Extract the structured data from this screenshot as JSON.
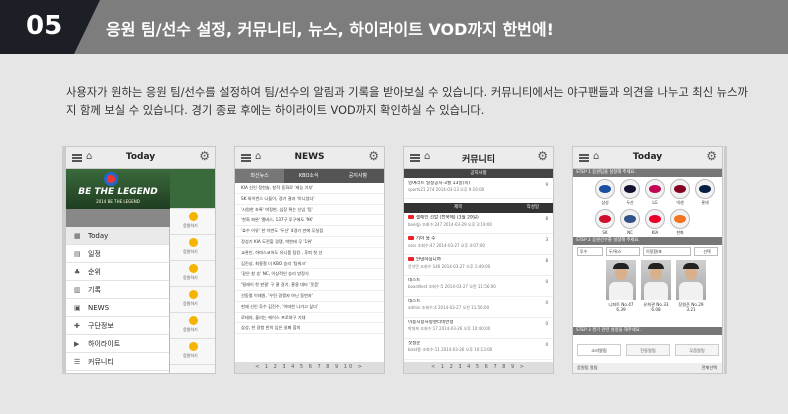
{
  "banner": {
    "number": "05",
    "title": "응원 팀/선수 설정, 커뮤니티, 뉴스, 하이라이트 VOD까지 한번에!"
  },
  "description": "사용자가 원하는 응원 팀/선수를 설정하여 팀/선수의 알림과 기록을 받아보실 수 있습니다. 커뮤니티에서는 야구팬들과 의견을 나누고 최신 뉴스까지 함께 보실 수 있습니다. 경기 종료 후에는 하이라이트 VOD까지 확인하실 수 있습니다.",
  "screen1": {
    "title": "Today",
    "promo": {
      "line1": "BE THE LEGEND",
      "line2": "2014 BE THE LEGEND"
    },
    "menu": [
      "Today",
      "일정",
      "순위",
      "기록",
      "NEWS",
      "구단정보",
      "하이라이트",
      "커뮤니티"
    ],
    "side_label": "응원하기"
  },
  "screen2": {
    "title": "NEWS",
    "tabs": [
      "최신뉴스",
      "KBO소식",
      "공지사항"
    ],
    "items": [
      "KIA 신인 정한솔, 창작 동화로 '재능 기부'",
      "SK 와이번스 나들이, 경기 결과 '아니었다'",
      "'시원한 초록' 박정현, 심장 뛰는 신입 '팀'",
      "'한화 좌완' 앨버스, 137구 투구에도 '9K'",
      "'효수 이유' 한 이번도 '두산' 4경기 만에 무실점",
      "정성기 KIA 도전할 경쟁, 박한테 무 '1위'",
      "교관인, 하마스코어도 유니폼 팀킹 , 후퇴 첫 선",
      "김진성, 최용철 더 KBO 승리 '팀워크'",
      "'같은 창 승' NC, 이상적인 승리 방정식",
      "'릴레이 첫 판결' 구 클 경기, 홍용 대타 '웃음'",
      "선동렬 이재원, '우린 경쟁자 아닌 동반자'",
      "현재 신인 투수 김진수, '어떠한 나가고 싶다'",
      "로테자, 울리는 에이스 프로야구 기대",
      "삼성, 한 경험 한의 입은 실패 합의"
    ],
    "pages": "< 1 2 3 4 5 6 7 8 9 10 >"
  },
  "screen3": {
    "title": "커뮤니티",
    "notice": "공지사항",
    "pinned": {
      "title": "잉여러트 일정공지-3월 13일(목)",
      "meta": "sports21   274   2014-03-13 오후 9:16:00",
      "count": "9"
    },
    "columns": [
      "제목",
      "작성일"
    ],
    "posts": [
      {
        "title": "젤레인 선발 (전북에) (3월 29일)",
        "meta": "beerJp   조회수:247   2014-03-29 오후 3:19:00",
        "count": "8"
      },
      {
        "title": "기아 용 수",
        "meta": "ssss   조회수:47   2014-03-27 오후 4:07:00",
        "count": "3"
      },
      {
        "title": "안녕하십니까",
        "meta": "윤석민   조회수:146   2014-03-27 오후 1:49:00",
        "count": "8"
      },
      {
        "title": "테스트",
        "meta": "boardtest   조회수:5   2014-03-27 오전 11:56:00",
        "count": "0"
      },
      {
        "title": "테스트",
        "meta": "admin   조회수:4   2014-03-27 오전 11:56:00",
        "count": "0"
      },
      {
        "title": "이용시용사항센터테반정",
        "meta": "박대희   조회수:17   2014-03-26 오후 10:40:00",
        "count": "0"
      },
      {
        "title": "첫질문",
        "meta": "bisst용   조회수:11   2014-03-26 오후 10:13:00",
        "count": "0"
      }
    ],
    "pages": "< 1 2 3 4 5 6 7 8 9 >"
  },
  "screen4": {
    "title": "Today",
    "step1": "STEP 1 응원팀을 설정해 주세요.",
    "teams": [
      "삼성",
      "두산",
      "LG",
      "넥센",
      "롯데",
      "SK",
      "NC",
      "KIA",
      "한화"
    ],
    "step2": "STEP 2 응원선수를 설정해 주세요.",
    "selects": [
      "투수",
      "두/워스",
      "이정환/포",
      "선택"
    ],
    "players": [
      {
        "name": "니퍼트 No.47",
        "stat": "6.39"
      },
      {
        "name": "유희관 No.33",
        "stat": "6.08"
      },
      {
        "name": "장원준 No.29",
        "stat": "3.21"
      }
    ],
    "step3": "STEP 3 경기 관련 설정을 해주세요.",
    "buttons": [
      "소리알림",
      "진동알림",
      "무음알림"
    ],
    "footer_left": "응원팀 알림",
    "footer_right": "전체선택"
  },
  "colors": {
    "banner_dark": "#1d1f26",
    "banner_gray": "#7d7d7d",
    "promo_green": "#3a6a3c",
    "youtube_red": "#e22"
  }
}
